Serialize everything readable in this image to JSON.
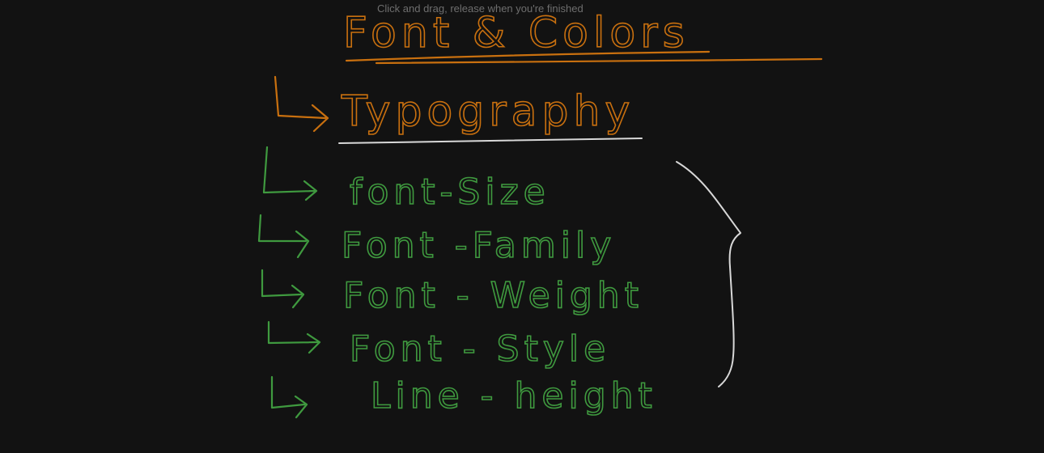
{
  "hint": "Click and drag, release when you're finished",
  "title": "Font & Colors",
  "subheading": "Typography",
  "properties": [
    "font-Size",
    "Font -Family",
    "Font - Weight",
    "Font - Style",
    "Line - height"
  ],
  "colors": {
    "background": "#121212",
    "orange_ink": "#c9700f",
    "green_ink": "#3f9a3f",
    "white_ink": "#d8d8d8",
    "hint_text": "#6e6e6e"
  }
}
